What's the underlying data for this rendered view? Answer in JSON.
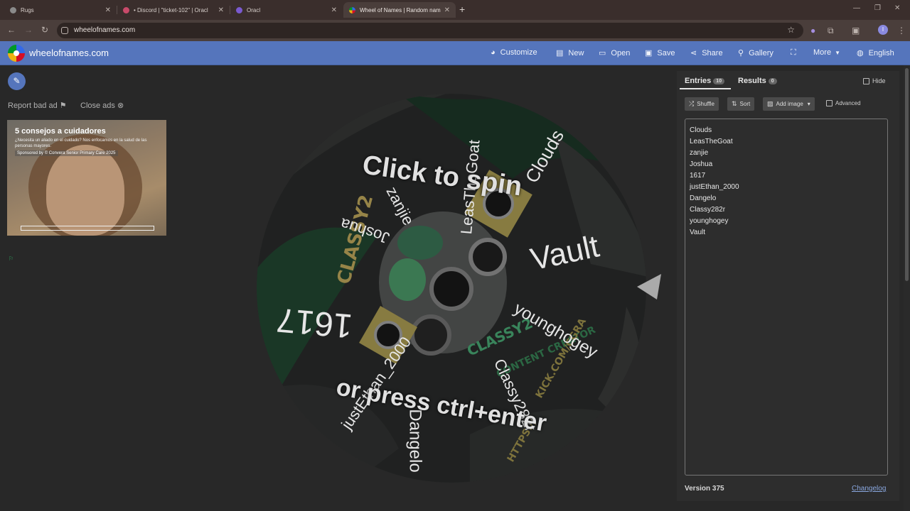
{
  "browser": {
    "tabs": [
      {
        "title": "Rugs"
      },
      {
        "title": "• Discord | \"ticket-102\" | Oracl"
      },
      {
        "title": "Oracl"
      },
      {
        "title": "Wheel of Names | Random nam"
      }
    ],
    "url": "wheelofnames.com",
    "profile_initial": "I"
  },
  "header": {
    "brand": "wheelofnames.com",
    "menu": [
      "Customize",
      "New",
      "Open",
      "Save",
      "Share",
      "Gallery",
      "More",
      "English"
    ]
  },
  "ads": {
    "report_bad_ad": "Report bad ad",
    "close_ads": "Close ads",
    "title": "5 consejos a cuidadores",
    "body": "¿Necesita un aliado en el cuidado? Nos enfocamos en la salud de las personas mayores.",
    "sponsor": "Sponsored by © Convera Senior Primary Care 2025"
  },
  "wheel": {
    "cta_line1": "Click to spin",
    "cta_line2": "or press ctrl+enter",
    "labels": [
      "Clouds",
      "LeasTheGoat",
      "zanjie",
      "Joshua",
      "1617",
      "justEthan_2000",
      "Dangelo",
      "Classy282r",
      "younghogey",
      "Vault"
    ]
  },
  "panel": {
    "entries_tab": "Entries",
    "entries_count": "10",
    "results_tab": "Results",
    "results_count": "0",
    "hide_label": "Hide",
    "shuffle": "Shuffle",
    "sort": "Sort",
    "add_image": "Add image",
    "advanced": "Advanced",
    "entries": [
      "Clouds",
      "LeasTheGoat",
      "zanjie",
      "Joshua",
      "1617",
      "justEthan_2000",
      "Dangelo",
      "Classy282r",
      "younghogey",
      "Vault"
    ],
    "version": "Version 375",
    "changelog": "Changelog"
  }
}
